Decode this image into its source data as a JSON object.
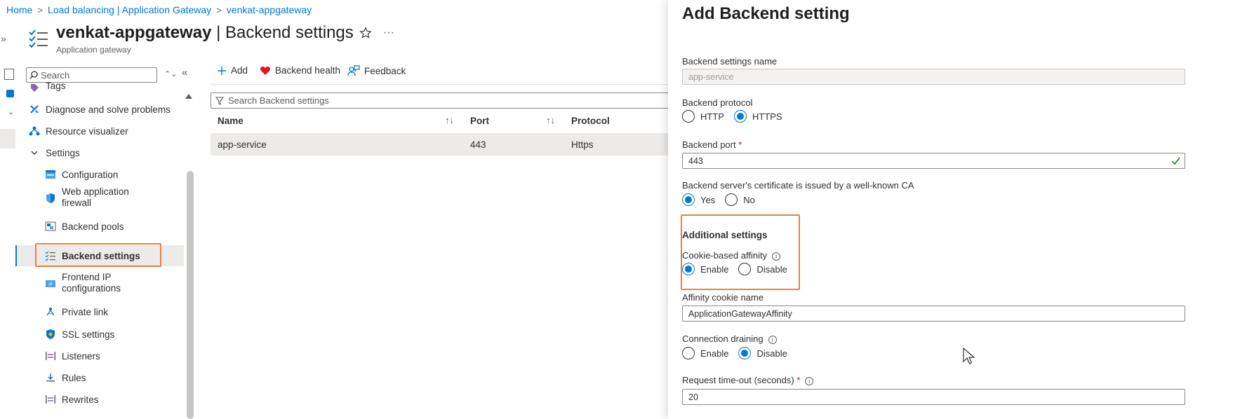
{
  "breadcrumb": [
    "Home",
    "Load balancing | Application Gateway",
    "venkat-appgateway"
  ],
  "resource": {
    "name": "venkat-appgateway",
    "separator": " | ",
    "page": "Backend settings",
    "type": "Application gateway"
  },
  "sidebar": {
    "search_placeholder": "Search",
    "items": [
      {
        "label": "Tags",
        "icon": "tag-icon"
      },
      {
        "label": "Diagnose and solve problems",
        "icon": "wrench-icon"
      },
      {
        "label": "Resource visualizer",
        "icon": "hierarchy-icon"
      },
      {
        "label": "Settings",
        "icon": "chevron-down-icon"
      },
      {
        "label": "Configuration",
        "icon": "configuration-icon"
      },
      {
        "label": "Web application",
        "label2": "firewall",
        "icon": "shield-icon"
      },
      {
        "label": "Backend pools",
        "icon": "backend-pools-icon"
      },
      {
        "label": "Backend settings",
        "icon": "backend-settings-icon",
        "selected": true
      },
      {
        "label": "Frontend IP",
        "label2": "configurations",
        "icon": "frontend-ip-icon"
      },
      {
        "label": "Private link",
        "icon": "private-link-icon"
      },
      {
        "label": "SSL settings",
        "icon": "ssl-shield-icon"
      },
      {
        "label": "Listeners",
        "icon": "listeners-icon"
      },
      {
        "label": "Rules",
        "icon": "rules-icon"
      },
      {
        "label": "Rewrites",
        "icon": "rewrites-icon"
      }
    ]
  },
  "toolbar": {
    "add": "Add",
    "backend_health": "Backend health",
    "feedback": "Feedback"
  },
  "grid": {
    "filter_placeholder": "Search Backend settings",
    "columns": [
      "Name",
      "Port",
      "Protocol"
    ],
    "rows": [
      {
        "name": "app-service",
        "port": "443",
        "protocol": "Https"
      }
    ]
  },
  "panel": {
    "title": "Add Backend setting",
    "name_label": "Backend settings name",
    "name_value": "app-service",
    "protocol_label": "Backend protocol",
    "protocol_options": [
      "HTTP",
      "HTTPS"
    ],
    "protocol_selected": "HTTPS",
    "port_label": "Backend port",
    "port_required": "*",
    "port_value": "443",
    "cert_label": "Backend server's certificate is issued by a well-known CA",
    "cert_options": [
      "Yes",
      "No"
    ],
    "cert_selected": "Yes",
    "additional_heading": "Additional settings",
    "affinity_label": "Cookie-based affinity",
    "affinity_options": [
      "Enable",
      "Disable"
    ],
    "affinity_selected": "Enable",
    "cookie_name_label": "Affinity cookie name",
    "cookie_name_value": "ApplicationGatewayAffinity",
    "draining_label": "Connection draining",
    "draining_options": [
      "Enable",
      "Disable"
    ],
    "draining_selected": "Disable",
    "timeout_label": "Request time-out (seconds)",
    "timeout_required": "*",
    "timeout_value": "20"
  },
  "colors": {
    "accent": "#0078d4",
    "highlight": "#e6823c",
    "valid": "#107c10",
    "heart": "#e81123"
  }
}
